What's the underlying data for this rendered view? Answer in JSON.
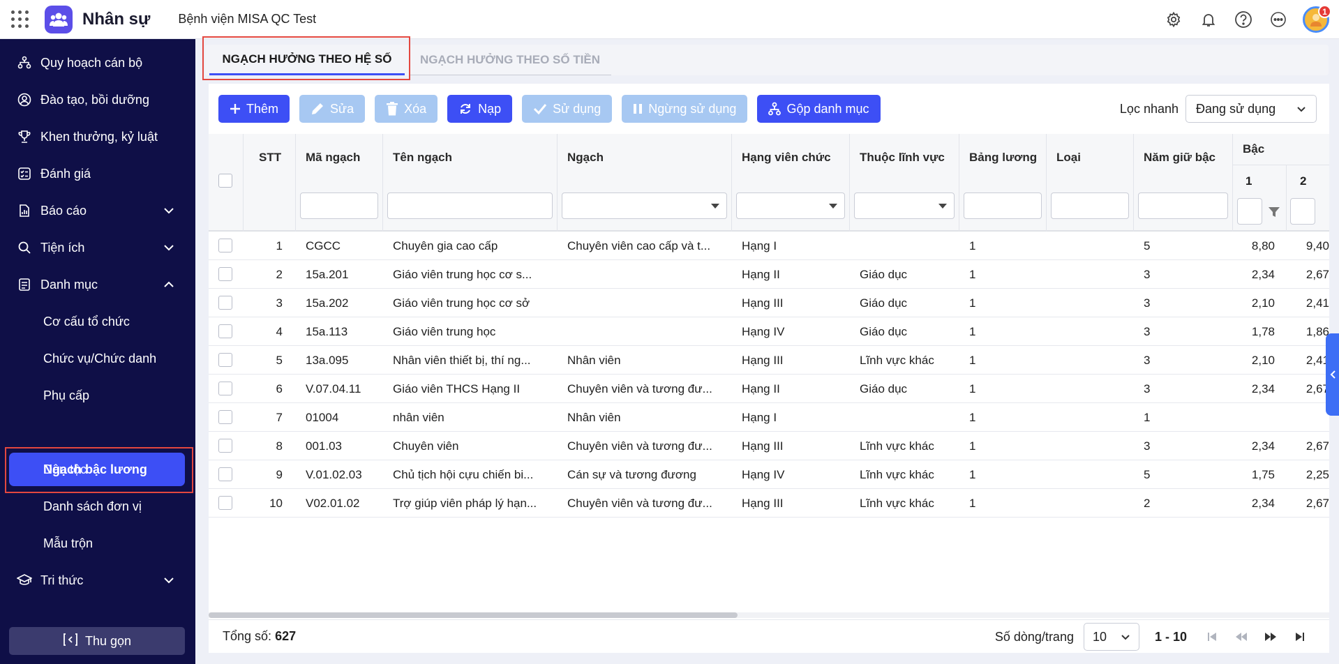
{
  "header": {
    "app_name": "Nhân sự",
    "org_name": "Bệnh viện MISA QC Test",
    "notification_count": "1"
  },
  "sidebar": {
    "items": [
      {
        "label": "Quy hoạch cán bộ",
        "icon": "org-chart-icon"
      },
      {
        "label": "Đào tạo, bồi dưỡng",
        "icon": "user-badge-icon"
      },
      {
        "label": "Khen thưởng, kỷ luật",
        "icon": "trophy-icon"
      },
      {
        "label": "Đánh giá",
        "icon": "checklist-icon"
      },
      {
        "label": "Báo cáo",
        "icon": "report-icon"
      },
      {
        "label": "Tiện ích",
        "icon": "search-icon"
      },
      {
        "label": "Danh mục",
        "icon": "list-icon"
      }
    ],
    "sub_items": [
      "Cơ cấu tổ chức",
      "Chức vụ/Chức danh",
      "Phụ cấp",
      "Ngạch bậc lương",
      "Dân tộc",
      "Danh sách đơn vị",
      "Mẫu trộn"
    ],
    "last_item": "Tri thức",
    "collapse_label": "Thu gọn"
  },
  "tabs": [
    "NGẠCH HƯỞNG THEO HỆ SỐ",
    "NGẠCH HƯỞNG THEO SỐ TIỀN"
  ],
  "toolbar": {
    "add": "Thêm",
    "edit": "Sửa",
    "delete": "Xóa",
    "reload": "Nạp",
    "use": "Sử dụng",
    "stop": "Ngừng sử dụng",
    "merge": "Gộp danh mục",
    "quick_filter_label": "Lọc nhanh",
    "quick_filter_value": "Đang sử dụng"
  },
  "table": {
    "headers": {
      "stt": "STT",
      "code": "Mã ngạch",
      "name": "Tên ngạch",
      "grade": "Ngạch",
      "rank": "Hạng viên chức",
      "field": "Thuộc lĩnh vực",
      "table": "Bảng lương",
      "type": "Loại",
      "years": "Năm giữ bậc",
      "level": "Bậc",
      "level1": "1",
      "level2": "2"
    },
    "rows": [
      [
        "1",
        "CGCC",
        "Chuyên gia cao cấp",
        "Chuyên viên cao cấp và t...",
        "Hạng I",
        "",
        "1",
        "",
        "5",
        "8,80",
        "9,40"
      ],
      [
        "2",
        "15a.201",
        "Giáo viên trung học cơ s...",
        "",
        "Hạng II",
        "Giáo dục",
        "1",
        "",
        "3",
        "2,34",
        "2,67"
      ],
      [
        "3",
        "15a.202",
        "Giáo viên trung học cơ sở",
        "",
        "Hạng III",
        "Giáo dục",
        "1",
        "",
        "3",
        "2,10",
        "2,41"
      ],
      [
        "4",
        "15a.113",
        "Giáo viên trung học",
        "",
        "Hạng IV",
        "Giáo dục",
        "1",
        "",
        "3",
        "1,78",
        "1,86"
      ],
      [
        "5",
        "13a.095",
        "Nhân viên thiết bị, thí ng...",
        "Nhân viên",
        "Hạng III",
        "Lĩnh vực khác",
        "1",
        "",
        "3",
        "2,10",
        "2,41"
      ],
      [
        "6",
        "V.07.04.11",
        "Giáo viên THCS Hạng II",
        "Chuyên viên và tương đư...",
        "Hạng II",
        "Giáo dục",
        "1",
        "",
        "3",
        "2,34",
        "2,67"
      ],
      [
        "7",
        "01004",
        "nhân viên",
        "Nhân viên",
        "Hạng I",
        "",
        "1",
        "",
        "1",
        "",
        ""
      ],
      [
        "8",
        "001.03",
        "Chuyên viên",
        "Chuyên viên và tương đư...",
        "Hạng III",
        "Lĩnh vực khác",
        "1",
        "",
        "3",
        "2,34",
        "2,67"
      ],
      [
        "9",
        "V.01.02.03",
        "Chủ tịch hội cựu chiến bi...",
        "Cán sự và tương đương",
        "Hạng IV",
        "Lĩnh vực khác",
        "1",
        "",
        "5",
        "1,75",
        "2,25"
      ],
      [
        "10",
        "V02.01.02",
        "Trợ giúp viên pháp lý hạn...",
        "Chuyên viên và tương đư...",
        "Hạng III",
        "Lĩnh vực khác",
        "1",
        "",
        "2",
        "2,34",
        "2,67"
      ]
    ]
  },
  "footer": {
    "total_label": "Tổng số:",
    "total_value": "627",
    "page_size_label": "Số dòng/trang",
    "page_size_value": "10",
    "range": "1 - 10"
  }
}
